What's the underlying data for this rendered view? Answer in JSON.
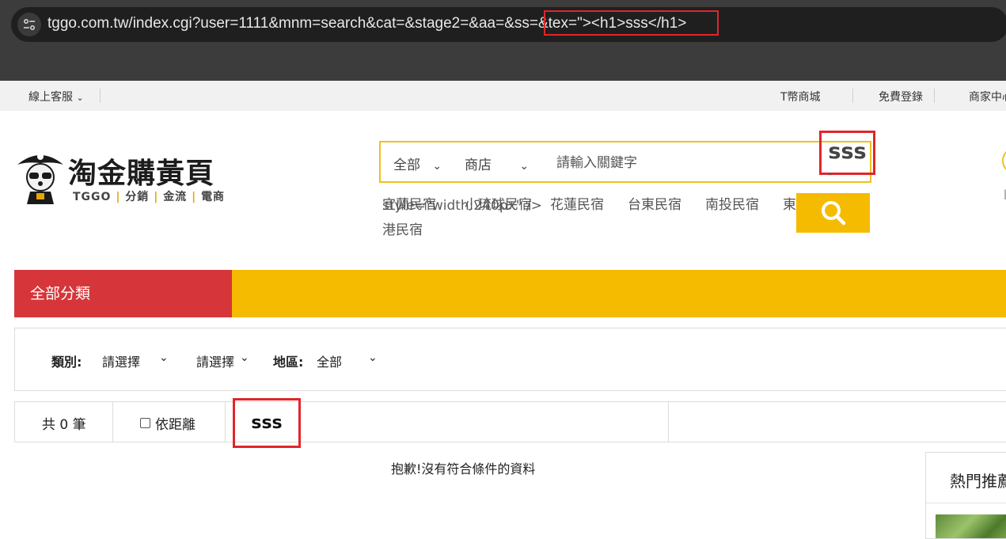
{
  "browser": {
    "url": "tggo.com.tw/index.cgi?user=1111&mnm=search&cat=&stage2=&aa=&ss=&tex=\"><h1>sss</h1>"
  },
  "util_bar": {
    "support": "線上客服",
    "tcoin_mall": "T幣商城",
    "register": "免費登錄",
    "merchant": "商家中心"
  },
  "logo": {
    "title": "淘金購黃頁",
    "sub_brand": "TGGO",
    "sub_1": "分銷",
    "sub_2": "金流",
    "sub_3": "電商",
    "divider": "|"
  },
  "search": {
    "category": "全部",
    "type": "商店",
    "placeholder": "請輸入關鍵字",
    "injected_text": "sss",
    "stray_quote": "\""
  },
  "hot_tags": [
    "宜蘭民宿",
    "小琉球民宿",
    "花蓮民宿",
    "台東民宿",
    "南投民宿",
    "東",
    "港民宿"
  ],
  "leaked_attr": "style=\"width:240px\" />",
  "nav": {
    "all_categories": "全部分類"
  },
  "filters": {
    "category_label": "類別:",
    "category_value": "請選擇",
    "sub_value": "請選擇",
    "region_label": "地區:",
    "region_value": "全部"
  },
  "results": {
    "count_text": "共 0 筆",
    "distance_label": "依距離",
    "injected_heading": "sss",
    "empty_message": "抱歉!沒有符合條件的資料"
  },
  "sidebar": {
    "hot_title": "熱門推薦"
  },
  "colors": {
    "highlight_red": "#e0262b",
    "brand_yellow": "#f5bb00",
    "category_red": "#d6363a"
  }
}
